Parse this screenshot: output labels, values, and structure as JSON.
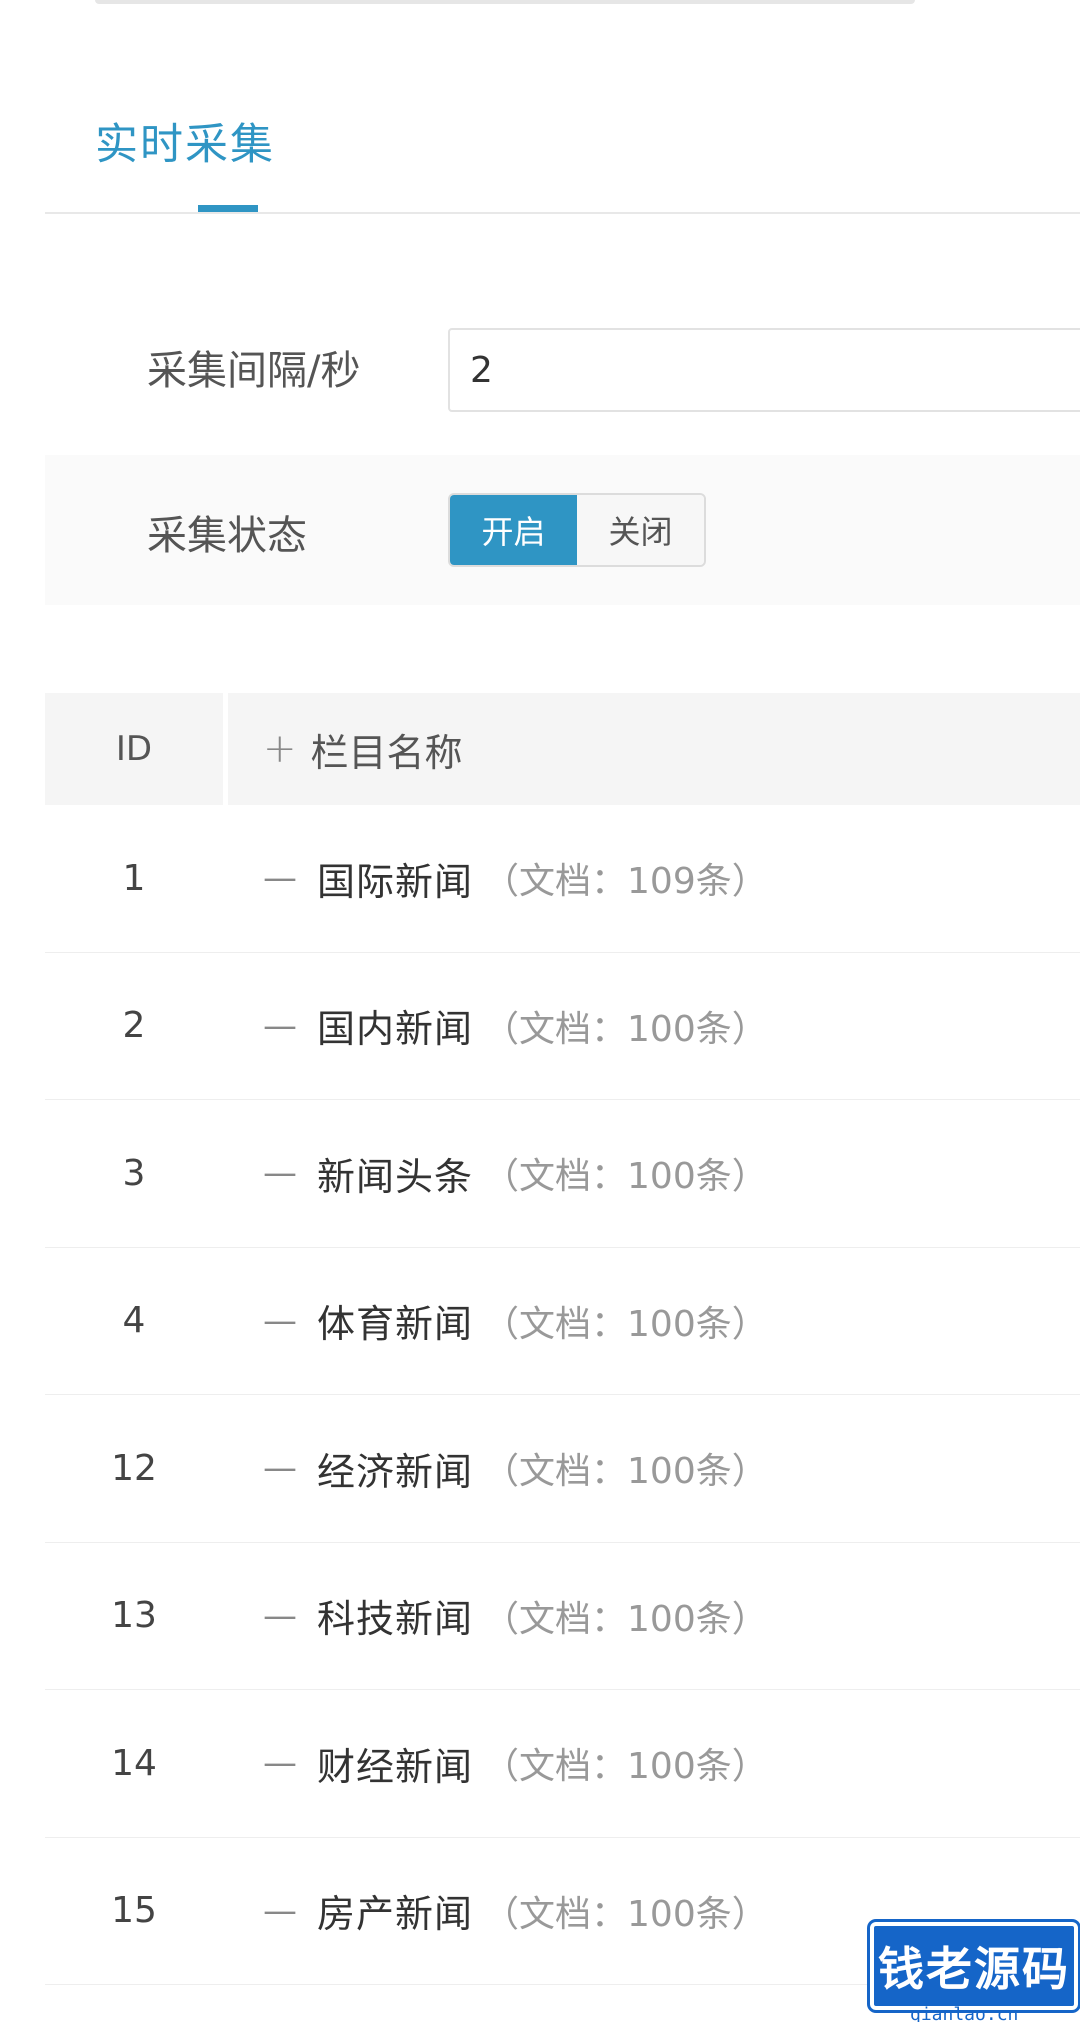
{
  "tab": {
    "label": "实时采集"
  },
  "form": {
    "interval_label": "采集间隔/秒",
    "interval_value": "2",
    "status_label": "采集状态",
    "status_on": "开启",
    "status_off": "关闭",
    "status_selected": "开启"
  },
  "table": {
    "headers": {
      "id": "ID",
      "name": "栏目名称"
    },
    "rows": [
      {
        "id": "1",
        "name": "国际新闻",
        "count": "（文档：109条）"
      },
      {
        "id": "2",
        "name": "国内新闻",
        "count": "（文档：100条）"
      },
      {
        "id": "3",
        "name": "新闻头条",
        "count": "（文档：100条）"
      },
      {
        "id": "4",
        "name": "体育新闻",
        "count": "（文档：100条）"
      },
      {
        "id": "12",
        "name": "经济新闻",
        "count": "（文档：100条）"
      },
      {
        "id": "13",
        "name": "科技新闻",
        "count": "（文档：100条）"
      },
      {
        "id": "14",
        "name": "财经新闻",
        "count": "（文档：100条）"
      },
      {
        "id": "15",
        "name": "房产新闻",
        "count": "（文档：100条）"
      }
    ]
  },
  "icons": {
    "plus": "+",
    "dash": "—"
  },
  "watermark": {
    "logo_text": "钱老源码",
    "site": "qianlao.cn"
  },
  "colors": {
    "accent": "#2f95c4",
    "watermark": "#1565c8"
  }
}
